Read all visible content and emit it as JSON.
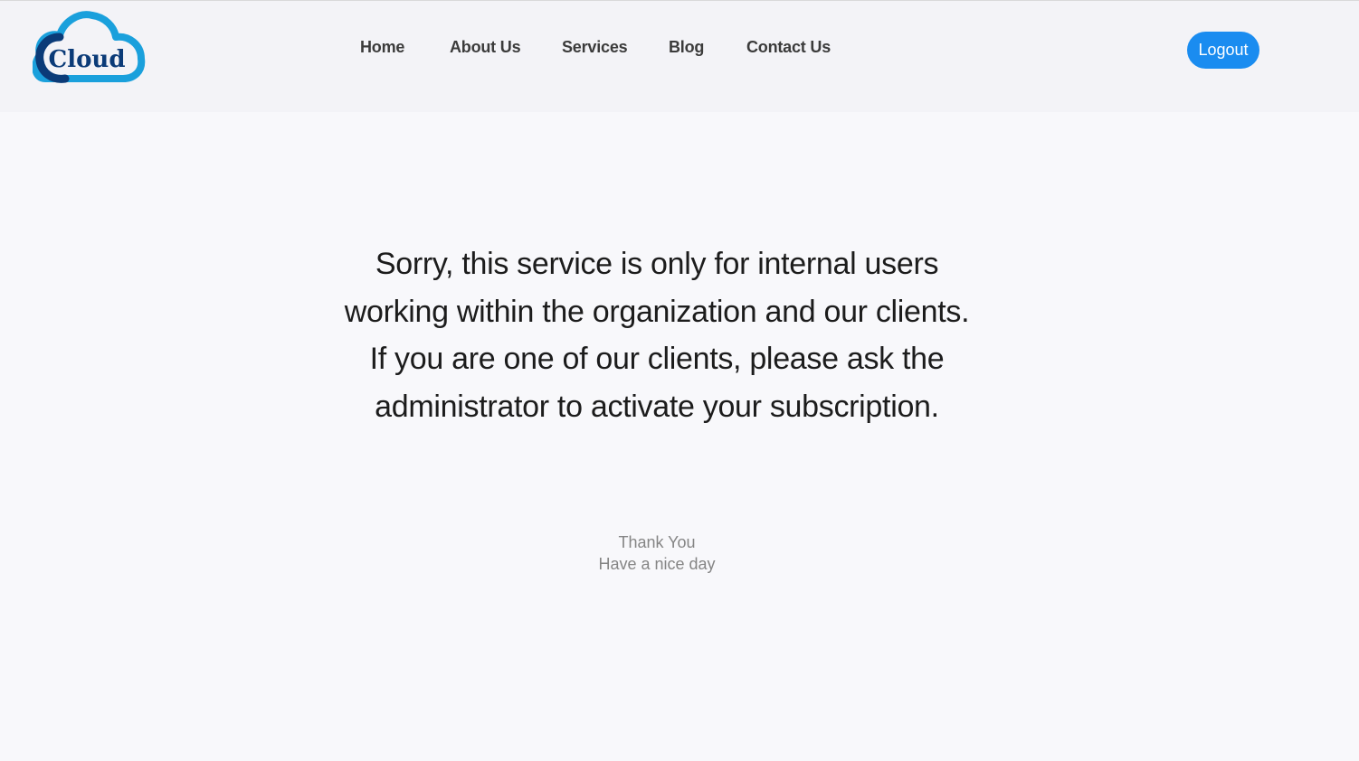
{
  "logo": {
    "text": "Cloud",
    "icon": "cloud-logo-icon",
    "color_dark": "#0b3b78",
    "color_light": "#1aa0dc"
  },
  "nav": {
    "items": [
      {
        "label": "Home"
      },
      {
        "label": "About Us"
      },
      {
        "label": "Services"
      },
      {
        "label": "Blog"
      },
      {
        "label": "Contact Us"
      }
    ]
  },
  "header": {
    "logout_label": "Logout",
    "accent": "#1a8cf0"
  },
  "main": {
    "message": "Sorry, this service is only for internal users working within the organization and our clients. If you are one of our clients, please ask the administrator to activate your subscription.",
    "thanks": "Thank You",
    "nice_day": "Have a nice day"
  }
}
